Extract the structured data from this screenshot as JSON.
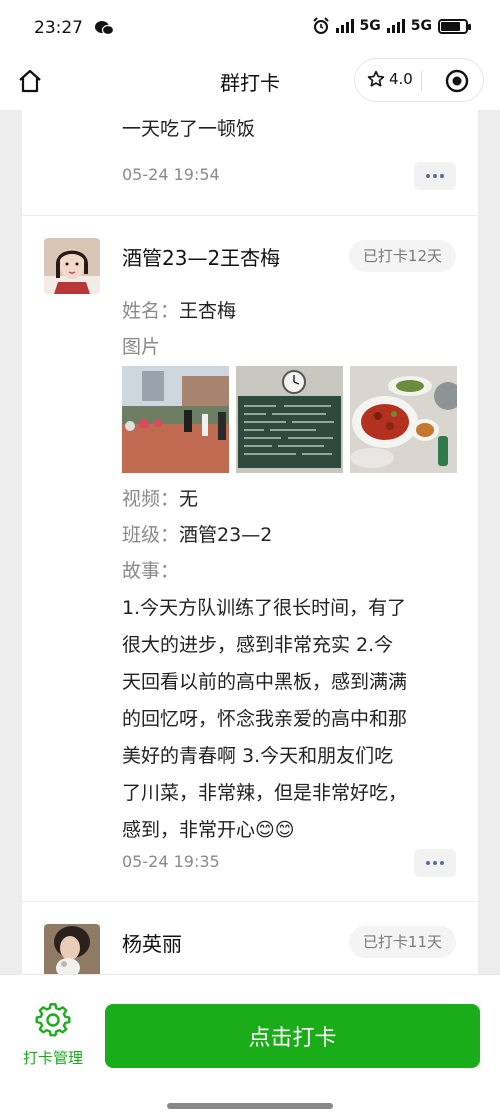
{
  "status_bar": {
    "time": "23:27",
    "network_1": "5G",
    "network_2": "5G"
  },
  "nav": {
    "title": "群打卡",
    "rating": "4.0"
  },
  "feed": {
    "post_prev": {
      "text": "一天吃了一顿饭",
      "time": "05-24 19:54"
    },
    "post_main": {
      "username": "酒管23—2王杏梅",
      "badge": "已打卡12天",
      "name_label": "姓名：",
      "name_value": "王杏梅",
      "images_label": "图片",
      "video_label": "视频：",
      "video_value": "无",
      "class_label": "班级：",
      "class_value": "酒管23—2",
      "story_label": "故事：",
      "story_lines": [
        "1.今天方队训练了很长时间，有了",
        "很大的进步，感到非常充实 2.今",
        "天回看以前的高中黑板，感到满满",
        "的回忆呀，怀念我亲爱的高中和那",
        "美好的青春啊 3.今天和朋友们吃",
        "了川菜，非常辣，但是非常好吃，",
        "感到，非常开心😊😊"
      ],
      "time": "05-24 19:35"
    },
    "post_next": {
      "username": "杨英丽",
      "badge": "已打卡11天"
    }
  },
  "bottom": {
    "manage_label": "打卡管理",
    "checkin_label": "点击打卡"
  },
  "colors": {
    "accent": "#1aad19",
    "background": "#ededed",
    "secondary_text": "#8a8a8a"
  }
}
